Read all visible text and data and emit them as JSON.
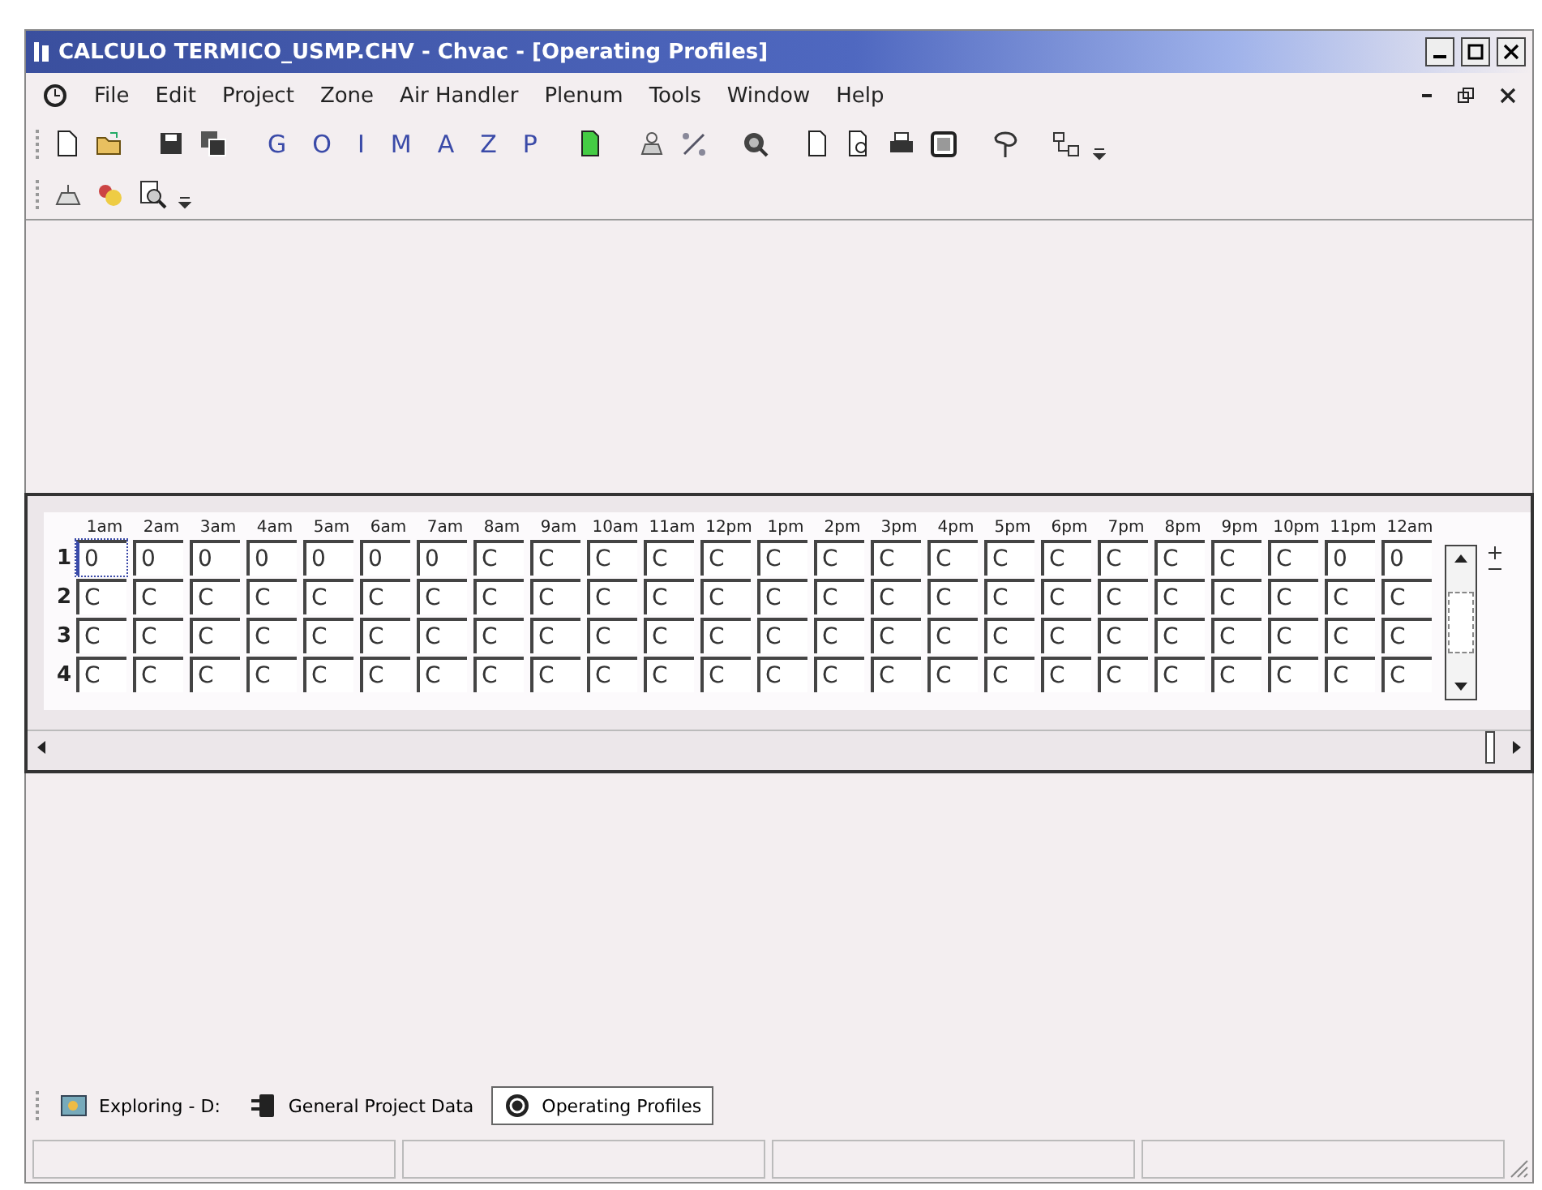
{
  "window": {
    "title": "CALCULO TERMICO_USMP.CHV - Chvac - [Operating Profiles]"
  },
  "menu": [
    {
      "label": "File"
    },
    {
      "label": "Edit"
    },
    {
      "label": "Project"
    },
    {
      "label": "Zone"
    },
    {
      "label": "Air Handler"
    },
    {
      "label": "Plenum"
    },
    {
      "label": "Tools"
    },
    {
      "label": "Window"
    },
    {
      "label": "Help"
    }
  ],
  "toolbar": [
    {
      "kind": "icon"
    },
    {
      "kind": "icon"
    },
    {
      "kind": "sep"
    },
    {
      "kind": "icon"
    },
    {
      "kind": "icon"
    },
    {
      "kind": "sep"
    },
    {
      "kind": "letter",
      "label": "G"
    },
    {
      "kind": "letter",
      "label": "O"
    },
    {
      "kind": "letter",
      "label": "I"
    },
    {
      "kind": "letter",
      "label": "M"
    },
    {
      "kind": "letter",
      "label": "A"
    },
    {
      "kind": "letter",
      "label": "Z"
    },
    {
      "kind": "letter",
      "label": "P"
    },
    {
      "kind": "sep"
    },
    {
      "kind": "icon"
    },
    {
      "kind": "sep"
    },
    {
      "kind": "icon"
    },
    {
      "kind": "icon"
    },
    {
      "kind": "sep"
    },
    {
      "kind": "icon"
    },
    {
      "kind": "sep"
    },
    {
      "kind": "icon"
    },
    {
      "kind": "icon"
    },
    {
      "kind": "icon"
    },
    {
      "kind": "icon"
    },
    {
      "kind": "sep"
    },
    {
      "kind": "icon"
    },
    {
      "kind": "sep"
    },
    {
      "kind": "icon"
    }
  ],
  "toolbar_2": [
    {
      "kind": "icon"
    },
    {
      "kind": "icon"
    },
    {
      "kind": "icon"
    }
  ],
  "grid": {
    "columns": [
      "1am",
      "2am",
      "3am",
      "4am",
      "5am",
      "6am",
      "7am",
      "8am",
      "9am",
      "10am",
      "11am",
      "12pm",
      "1pm",
      "2pm",
      "3pm",
      "4pm",
      "5pm",
      "6pm",
      "7pm",
      "8pm",
      "9pm",
      "10pm",
      "11pm",
      "12am"
    ],
    "rows": [
      {
        "label": "1",
        "cells": [
          {
            "value": "0",
            "selected": true
          },
          {
            "value": "0",
            "selected": false
          },
          {
            "value": "0",
            "selected": false
          },
          {
            "value": "0",
            "selected": false
          },
          {
            "value": "0",
            "selected": false
          },
          {
            "value": "0",
            "selected": false
          },
          {
            "value": "0",
            "selected": false
          },
          {
            "value": "C",
            "selected": false
          },
          {
            "value": "C",
            "selected": false
          },
          {
            "value": "C",
            "selected": false
          },
          {
            "value": "C",
            "selected": false
          },
          {
            "value": "C",
            "selected": false
          },
          {
            "value": "C",
            "selected": false
          },
          {
            "value": "C",
            "selected": false
          },
          {
            "value": "C",
            "selected": false
          },
          {
            "value": "C",
            "selected": false
          },
          {
            "value": "C",
            "selected": false
          },
          {
            "value": "C",
            "selected": false
          },
          {
            "value": "C",
            "selected": false
          },
          {
            "value": "C",
            "selected": false
          },
          {
            "value": "C",
            "selected": false
          },
          {
            "value": "C",
            "selected": false
          },
          {
            "value": "0",
            "selected": false
          },
          {
            "value": "0",
            "selected": false
          }
        ]
      },
      {
        "label": "2",
        "cells": [
          {
            "value": "C",
            "selected": false
          },
          {
            "value": "C",
            "selected": false
          },
          {
            "value": "C",
            "selected": false
          },
          {
            "value": "C",
            "selected": false
          },
          {
            "value": "C",
            "selected": false
          },
          {
            "value": "C",
            "selected": false
          },
          {
            "value": "C",
            "selected": false
          },
          {
            "value": "C",
            "selected": false
          },
          {
            "value": "C",
            "selected": false
          },
          {
            "value": "C",
            "selected": false
          },
          {
            "value": "C",
            "selected": false
          },
          {
            "value": "C",
            "selected": false
          },
          {
            "value": "C",
            "selected": false
          },
          {
            "value": "C",
            "selected": false
          },
          {
            "value": "C",
            "selected": false
          },
          {
            "value": "C",
            "selected": false
          },
          {
            "value": "C",
            "selected": false
          },
          {
            "value": "C",
            "selected": false
          },
          {
            "value": "C",
            "selected": false
          },
          {
            "value": "C",
            "selected": false
          },
          {
            "value": "C",
            "selected": false
          },
          {
            "value": "C",
            "selected": false
          },
          {
            "value": "C",
            "selected": false
          },
          {
            "value": "C",
            "selected": false
          }
        ]
      },
      {
        "label": "3",
        "cells": [
          {
            "value": "C",
            "selected": false
          },
          {
            "value": "C",
            "selected": false
          },
          {
            "value": "C",
            "selected": false
          },
          {
            "value": "C",
            "selected": false
          },
          {
            "value": "C",
            "selected": false
          },
          {
            "value": "C",
            "selected": false
          },
          {
            "value": "C",
            "selected": false
          },
          {
            "value": "C",
            "selected": false
          },
          {
            "value": "C",
            "selected": false
          },
          {
            "value": "C",
            "selected": false
          },
          {
            "value": "C",
            "selected": false
          },
          {
            "value": "C",
            "selected": false
          },
          {
            "value": "C",
            "selected": false
          },
          {
            "value": "C",
            "selected": false
          },
          {
            "value": "C",
            "selected": false
          },
          {
            "value": "C",
            "selected": false
          },
          {
            "value": "C",
            "selected": false
          },
          {
            "value": "C",
            "selected": false
          },
          {
            "value": "C",
            "selected": false
          },
          {
            "value": "C",
            "selected": false
          },
          {
            "value": "C",
            "selected": false
          },
          {
            "value": "C",
            "selected": false
          },
          {
            "value": "C",
            "selected": false
          },
          {
            "value": "C",
            "selected": false
          }
        ]
      },
      {
        "label": "4",
        "cells": [
          {
            "value": "C",
            "selected": false
          },
          {
            "value": "C",
            "selected": false
          },
          {
            "value": "C",
            "selected": false
          },
          {
            "value": "C",
            "selected": false
          },
          {
            "value": "C",
            "selected": false
          },
          {
            "value": "C",
            "selected": false
          },
          {
            "value": "C",
            "selected": false
          },
          {
            "value": "C",
            "selected": false
          },
          {
            "value": "C",
            "selected": false
          },
          {
            "value": "C",
            "selected": false
          },
          {
            "value": "C",
            "selected": false
          },
          {
            "value": "C",
            "selected": false
          },
          {
            "value": "C",
            "selected": false
          },
          {
            "value": "C",
            "selected": false
          },
          {
            "value": "C",
            "selected": false
          },
          {
            "value": "C",
            "selected": false
          },
          {
            "value": "C",
            "selected": false
          },
          {
            "value": "C",
            "selected": false
          },
          {
            "value": "C",
            "selected": false
          },
          {
            "value": "C",
            "selected": false
          },
          {
            "value": "C",
            "selected": false
          },
          {
            "value": "C",
            "selected": false
          },
          {
            "value": "C",
            "selected": false
          },
          {
            "value": "C",
            "selected": false
          }
        ]
      }
    ]
  },
  "tabs": [
    {
      "label": "Exploring - D:",
      "selected": false
    },
    {
      "label": "General Project Data",
      "selected": false
    },
    {
      "label": "Operating Profiles",
      "selected": true
    }
  ]
}
